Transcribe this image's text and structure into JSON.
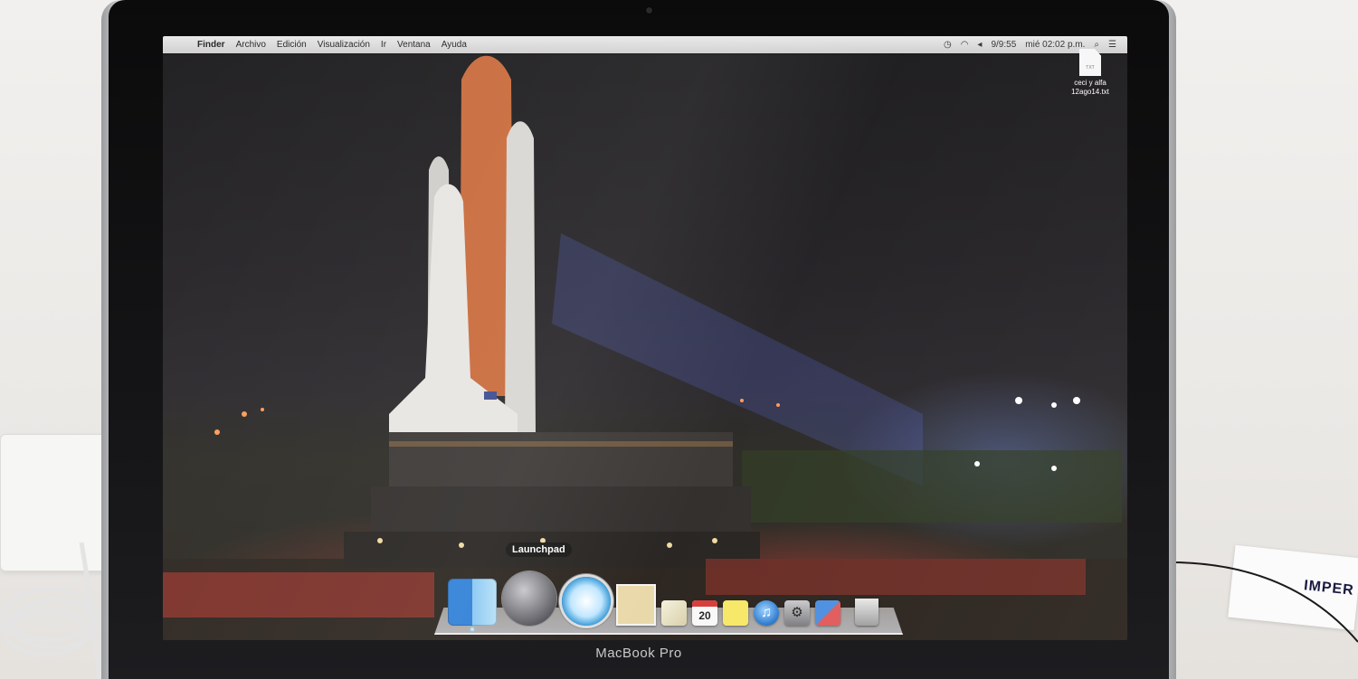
{
  "menubar": {
    "apple_glyph": "",
    "app_name": "Finder",
    "items": [
      "Archivo",
      "Edición",
      "Visualización",
      "Ir",
      "Ventana",
      "Ayuda"
    ],
    "status": {
      "battery": "9/9:55",
      "clock": "mié 02:02 p.m.",
      "wifi_icon": "wifi-icon",
      "volume_icon": "volume-icon",
      "search_icon": "spotlight-icon"
    }
  },
  "desktop": {
    "file": {
      "name_line1": "ceci y alfa",
      "name_line2": "12ago14.txt",
      "ext": "TXT"
    }
  },
  "dock": {
    "tooltip": "Launchpad",
    "calendar_day": "20",
    "itunes_glyph": "♫",
    "sysprefs_glyph": "⚙",
    "items": [
      "finder",
      "launchpad",
      "safari",
      "mail",
      "preview",
      "calendar",
      "stickies",
      "itunes",
      "system-preferences",
      "dashboard",
      "trash"
    ]
  },
  "hardware": {
    "brand": "MacBook Pro"
  },
  "desk": {
    "paper_text": "IMPER"
  },
  "colors": {
    "menubar": "#dcdcdc",
    "dock_shelf": "#e6e6ea",
    "screen_bg": "#221f22"
  }
}
